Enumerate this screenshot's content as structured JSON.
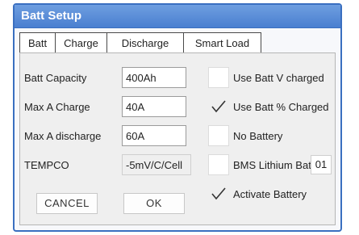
{
  "window": {
    "title": "Batt Setup"
  },
  "tabs": [
    {
      "label": "Batt"
    },
    {
      "label": "Charge"
    },
    {
      "label": "Discharge"
    },
    {
      "label": "Smart Load"
    }
  ],
  "fields": {
    "capacity": {
      "label": "Batt Capacity",
      "value": "400Ah"
    },
    "max_charge": {
      "label": "Max A Charge",
      "value": "40A"
    },
    "max_discharge": {
      "label": "Max A discharge",
      "value": "60A"
    },
    "tempco": {
      "label": "TEMPCO",
      "value": "-5mV/C/Cell"
    }
  },
  "options": {
    "use_batt_v": {
      "label": "Use Batt V charged",
      "checked": false
    },
    "use_batt_pct": {
      "label": "Use Batt % Charged",
      "checked": true
    },
    "no_battery": {
      "label": "No Battery",
      "checked": false
    },
    "bms_lithium": {
      "label": "BMS Lithium Batt",
      "checked": false,
      "value": "01"
    },
    "activate": {
      "label": "Activate Battery",
      "checked": true
    }
  },
  "buttons": {
    "cancel": "CANCEL",
    "ok": "OK"
  },
  "colors": {
    "titlebar": "#4a7fd0",
    "border": "#3a6fc0",
    "panel": "#efefef"
  }
}
